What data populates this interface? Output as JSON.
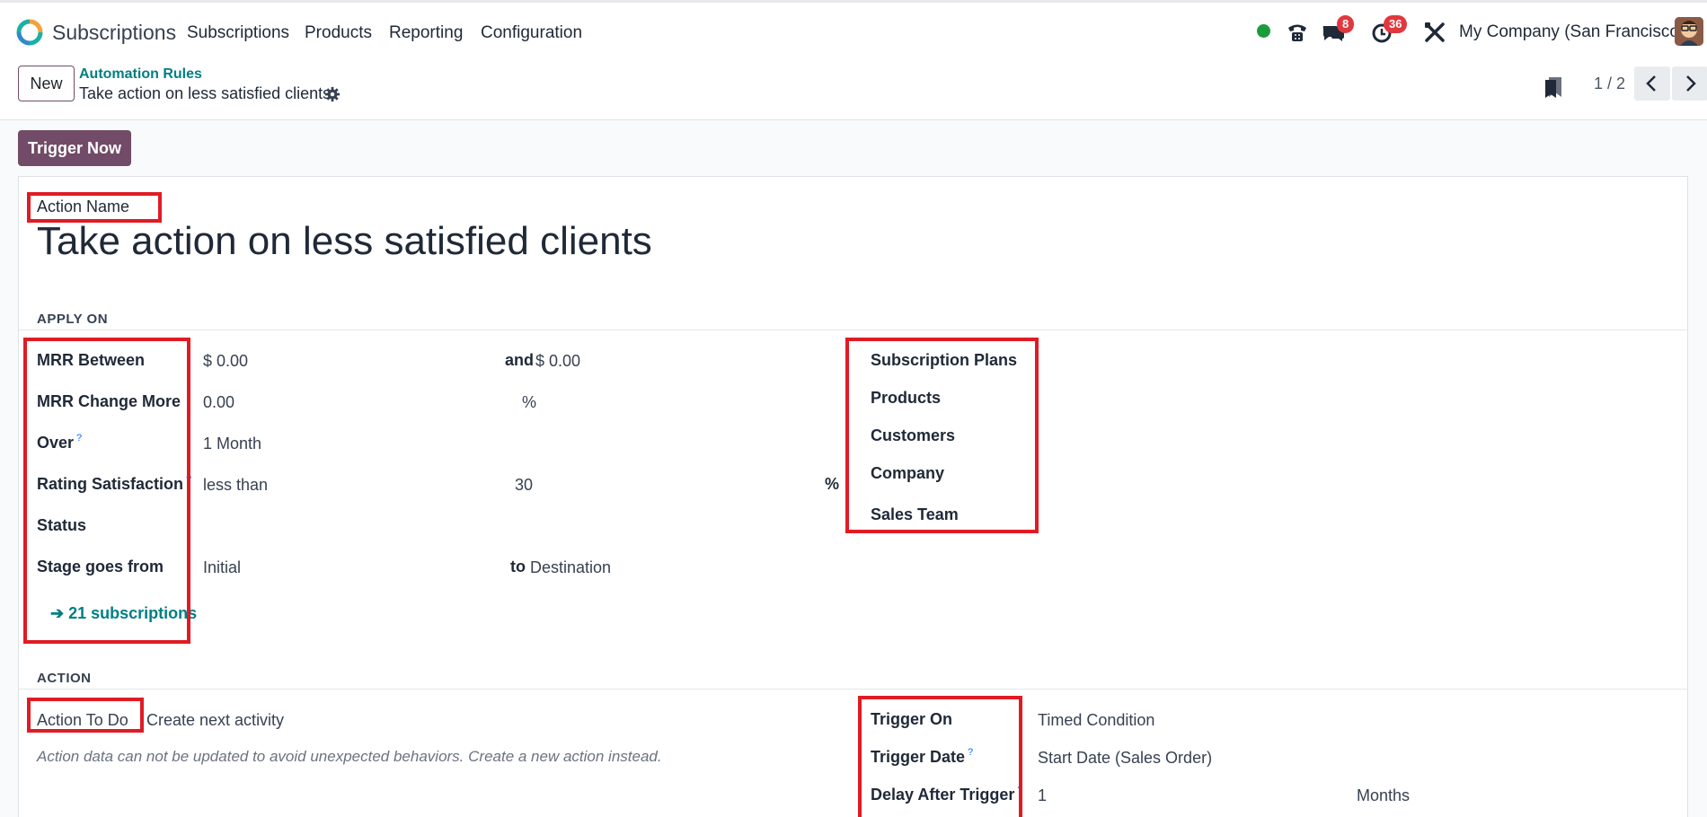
{
  "navbar": {
    "app_name": "Subscriptions",
    "menu": [
      "Subscriptions",
      "Products",
      "Reporting",
      "Configuration"
    ],
    "messages_count": "8",
    "activities_count": "36",
    "company": "My Company (San Francisco)"
  },
  "control_panel": {
    "new_label": "New",
    "breadcrumb_parent": "Automation Rules",
    "breadcrumb_current": "Take action on less satisfied clients",
    "pager": "1 / 2"
  },
  "buttons": {
    "trigger_now": "Trigger Now"
  },
  "form": {
    "action_name_label": "Action Name",
    "action_name": "Take action on less satisfied clients",
    "apply_on_header": "APPLY ON",
    "mrr_between_label": "MRR Between",
    "mrr_between_min": "$ 0.00",
    "mrr_and_label": "and",
    "mrr_between_max": "$ 0.00",
    "mrr_change_label": "MRR Change More",
    "mrr_change_value": "0.00",
    "mrr_change_unit": "%",
    "over_label": "Over",
    "over_value": "1 Month",
    "hint_mark": "?",
    "rating_label": "Rating Satisfaction",
    "rating_operator": "less than",
    "rating_value": "30",
    "rating_unit": "%",
    "status_label": "Status",
    "stage_label": "Stage goes from",
    "stage_from": "Initial",
    "stage_to_label": "to",
    "stage_to": "Destination",
    "smart_button": "➔ 21 subscriptions",
    "right_labels": {
      "subscription_plans": "Subscription Plans",
      "products": "Products",
      "customers": "Customers",
      "company": "Company",
      "sales_team": "Sales Team"
    },
    "action_header": "ACTION",
    "action_to_do_label": "Action To Do",
    "action_to_do_value": "Create next activity",
    "action_note": "Action data can not be updated to avoid unexpected behaviors. Create a new action instead.",
    "trigger_on_label": "Trigger On",
    "trigger_on_value": "Timed Condition",
    "trigger_date_label": "Trigger Date",
    "trigger_date_value": "Start Date (Sales Order)",
    "delay_label": "Delay After Trigger",
    "delay_value": "1",
    "delay_unit": "Months"
  },
  "colors": {
    "brand": "#714b67",
    "link": "#017e84",
    "highlight": "#e01b24",
    "badge": "#e0383e"
  }
}
